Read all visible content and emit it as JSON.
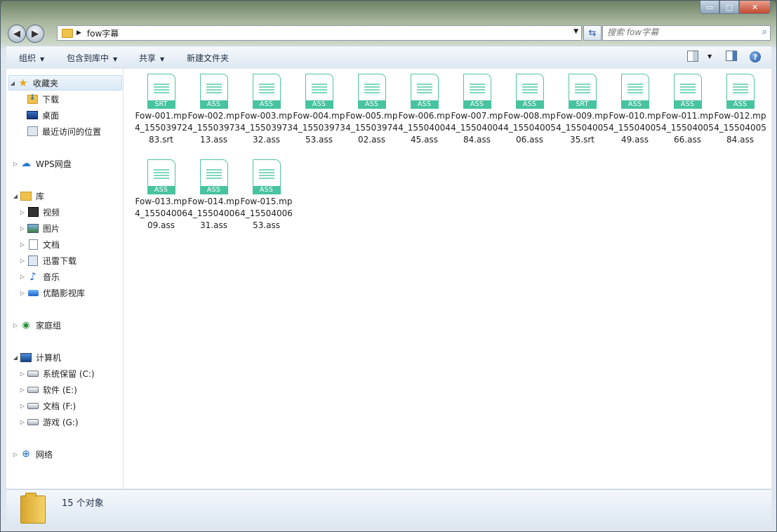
{
  "window": {
    "caption_buttons": {
      "minimize": "▭",
      "maximize": "□",
      "close": "✕"
    }
  },
  "address": {
    "path": "fow字幕",
    "search_placeholder": "搜索 fow字幕"
  },
  "toolbar": {
    "organize": "组织",
    "include_in_library": "包含到库中",
    "share": "共享",
    "new_folder": "新建文件夹"
  },
  "nav": {
    "favorites": "收藏夹",
    "downloads": "下载",
    "desktop": "桌面",
    "recent": "最近访问的位置",
    "wps": "WPS网盘",
    "libraries": "库",
    "videos": "视频",
    "pictures": "图片",
    "documents": "文档",
    "xunlei": "迅雷下载",
    "music": "音乐",
    "youku": "优酷影视库",
    "homegroup": "家庭组",
    "computer": "计算机",
    "drive_c": "系统保留 (C:)",
    "drive_e": "软件 (E:)",
    "drive_f": "文档 (F:)",
    "drive_g": "游戏 (G:)",
    "network": "网络"
  },
  "files": [
    {
      "type": "SRT",
      "name": "Fow-001.mp4_1550397283.srt"
    },
    {
      "type": "ASS",
      "name": "Fow-002.mp4_1550397313.ass"
    },
    {
      "type": "ASS",
      "name": "Fow-003.mp4_1550397332.ass"
    },
    {
      "type": "ASS",
      "name": "Fow-004.mp4_1550397353.ass"
    },
    {
      "type": "ASS",
      "name": "Fow-005.mp4_1550397402.ass"
    },
    {
      "type": "ASS",
      "name": "Fow-006.mp4_1550400445.ass"
    },
    {
      "type": "ASS",
      "name": "Fow-007.mp4_1550400484.ass"
    },
    {
      "type": "ASS",
      "name": "Fow-008.mp4_1550400506.ass"
    },
    {
      "type": "SRT",
      "name": "Fow-009.mp4_1550400535.srt"
    },
    {
      "type": "ASS",
      "name": "Fow-010.mp4_1550400549.ass"
    },
    {
      "type": "ASS",
      "name": "Fow-011.mp4_1550400566.ass"
    },
    {
      "type": "ASS",
      "name": "Fow-012.mp4_1550400584.ass"
    },
    {
      "type": "ASS",
      "name": "Fow-013.mp4_1550400609.ass"
    },
    {
      "type": "ASS",
      "name": "Fow-014.mp4_1550400631.ass"
    },
    {
      "type": "ASS",
      "name": "Fow-015.mp4_1550400653.ass"
    }
  ],
  "status": {
    "count": "15 个对象"
  },
  "colors": {
    "file_accent": "#48c3a0",
    "folder": "#f0c24b"
  }
}
